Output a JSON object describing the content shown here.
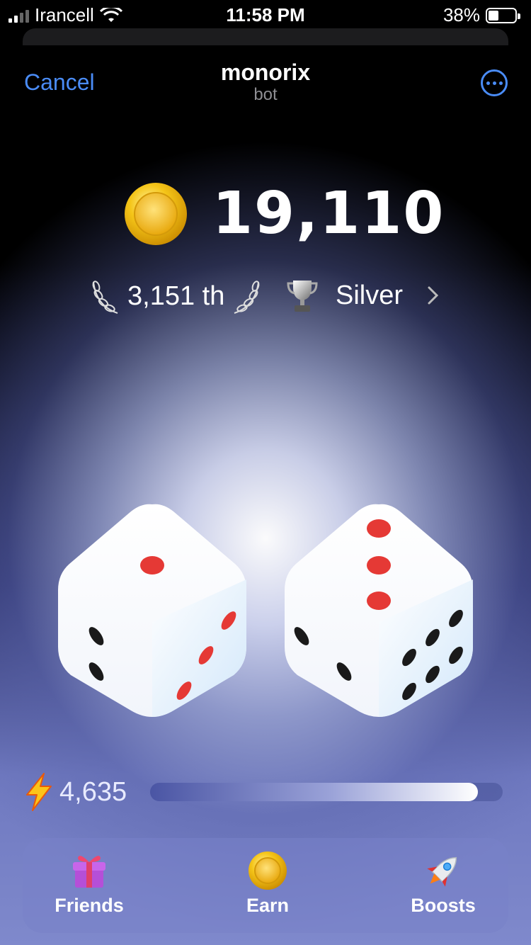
{
  "status_bar": {
    "carrier": "Irancell",
    "time": "11:58 PM",
    "battery": "38%",
    "battery_level": 0.38
  },
  "header": {
    "cancel_label": "Cancel",
    "title": "monorix",
    "subtitle": "bot"
  },
  "balance": {
    "value": "19,110",
    "icon": "coin-icon"
  },
  "rank": {
    "position": "3,151 th",
    "league": "Silver",
    "league_icon": "trophy-icon"
  },
  "dice": [
    {
      "top_face": 1,
      "left_face": 2,
      "right_face": 3
    },
    {
      "top_face": 3,
      "left_face": 2,
      "right_face": 6
    }
  ],
  "energy": {
    "value": "4,635",
    "progress": 0.93,
    "icon": "lightning-icon"
  },
  "nav": {
    "friends_label": "Friends",
    "earn_label": "Earn",
    "boosts_label": "Boosts"
  },
  "colors": {
    "accent": "#4a8cf7",
    "pip_red": "#e53935",
    "pip_black": "#1a1a1a"
  }
}
